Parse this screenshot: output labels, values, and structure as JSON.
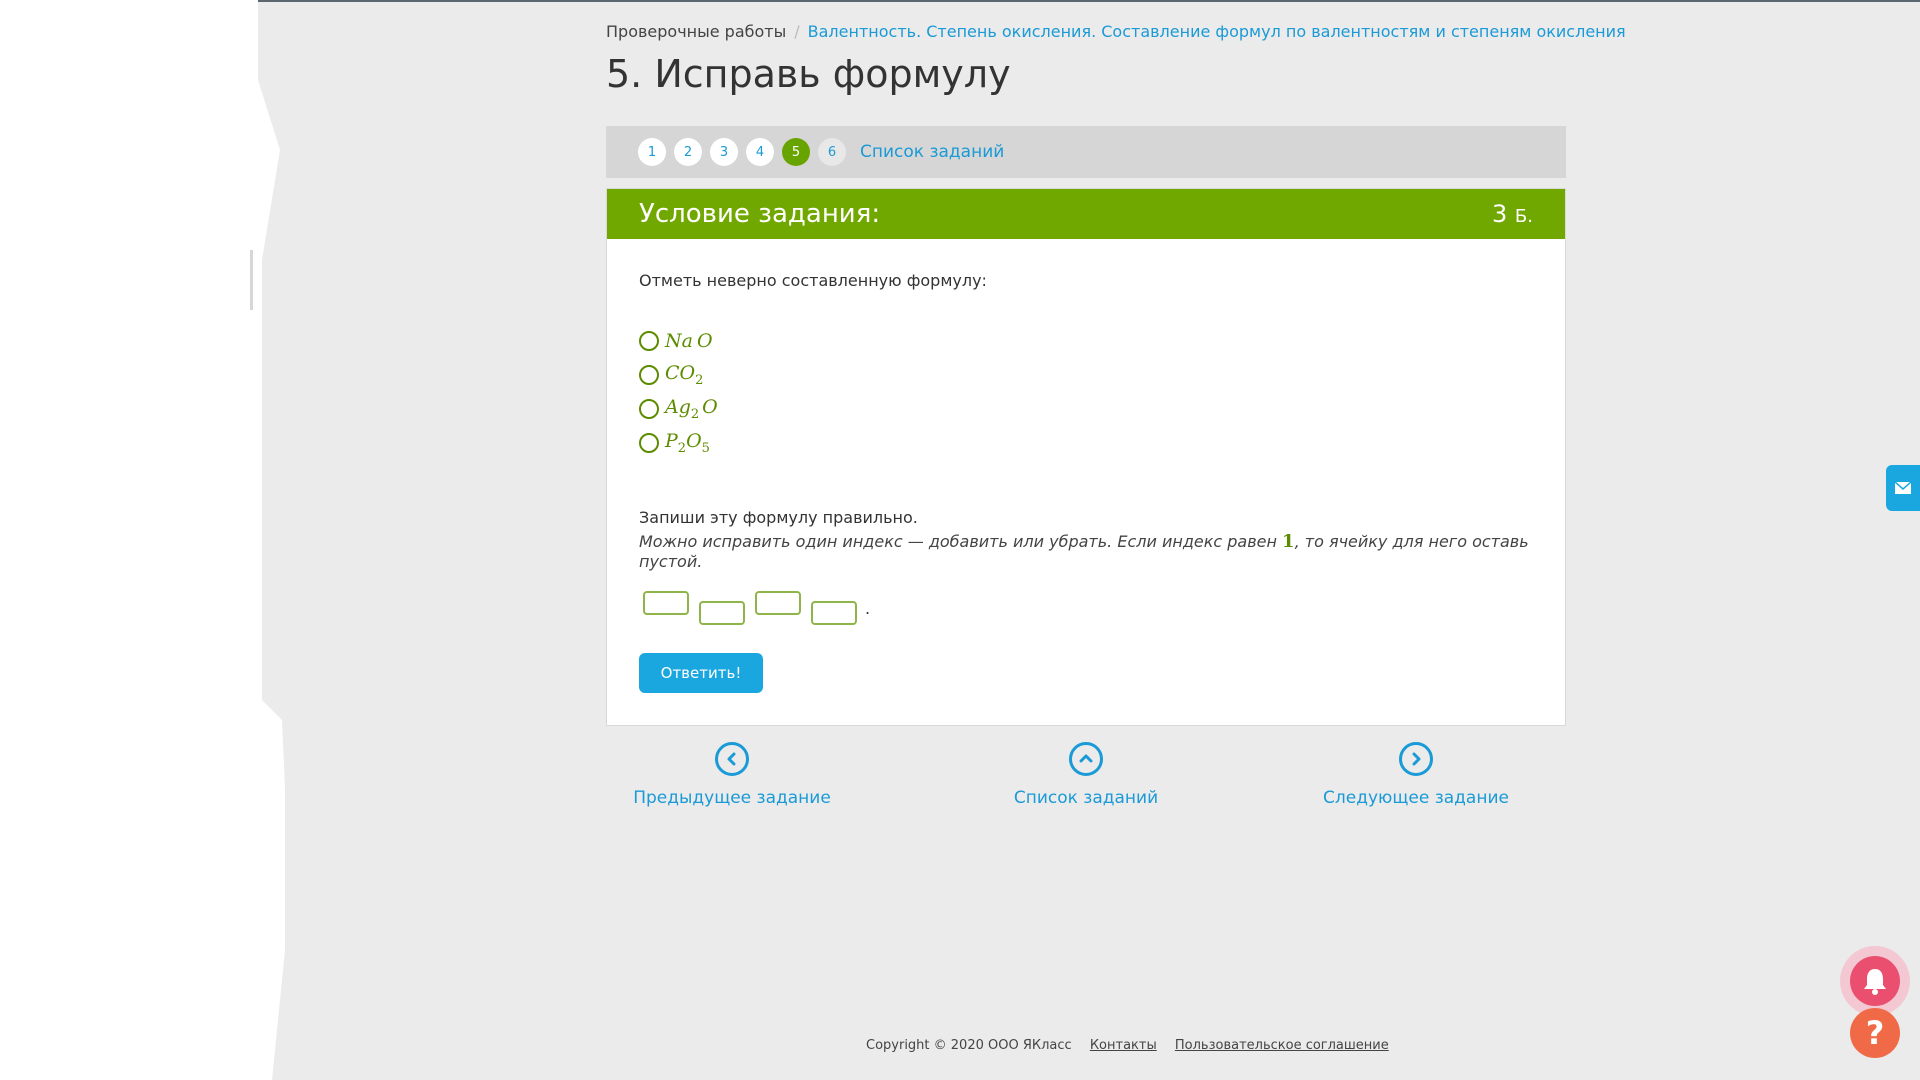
{
  "breadcrumb": {
    "root": "Проверочные работы",
    "separator": "/",
    "current": "Валентность. Степень окисления. Составление формул по валентностям и степеням окисления"
  },
  "page_title": "5. Исправь формулу",
  "task_nav": {
    "numbers": [
      "1",
      "2",
      "3",
      "4",
      "5",
      "6"
    ],
    "active": "5",
    "list_link": "Список заданий"
  },
  "card": {
    "header_title": "Условие задания:",
    "score_value": "3",
    "score_unit": "Б.",
    "instruction": "Отметь неверно составленную формулу:",
    "options": [
      {
        "parts": [
          [
            "Na",
            ""
          ],
          [
            "O",
            ""
          ]
        ]
      },
      {
        "parts": [
          [
            "CO",
            "2"
          ]
        ]
      },
      {
        "parts": [
          [
            "Ag",
            "2"
          ],
          [
            "O",
            ""
          ]
        ]
      },
      {
        "parts": [
          [
            "P",
            "2"
          ],
          [
            "O",
            "5"
          ]
        ]
      }
    ],
    "write_prompt": "Запиши эту формулу правильно.",
    "hint_before": "Можно исправить один индекс — добавить или убрать. Если индекс равен ",
    "hint_one": "1",
    "hint_after": ", то ячейку для него оставь пустой.",
    "answer_dot": ".",
    "submit_label": "Ответить!"
  },
  "bottom_nav": {
    "prev": "Предыдущее задание",
    "list": "Список заданий",
    "next": "Следующее задание"
  },
  "footer": {
    "copyright": "Copyright © 2020 ООО ЯКласс",
    "contacts": "Контакты",
    "agreement": "Пользовательское соглашение"
  },
  "colors": {
    "accent_green": "#71a800",
    "link_blue": "#1a9ad6",
    "button_blue": "#1aa7e0",
    "bell_pink": "#ea4f6f",
    "help_orange": "#f06a47"
  }
}
